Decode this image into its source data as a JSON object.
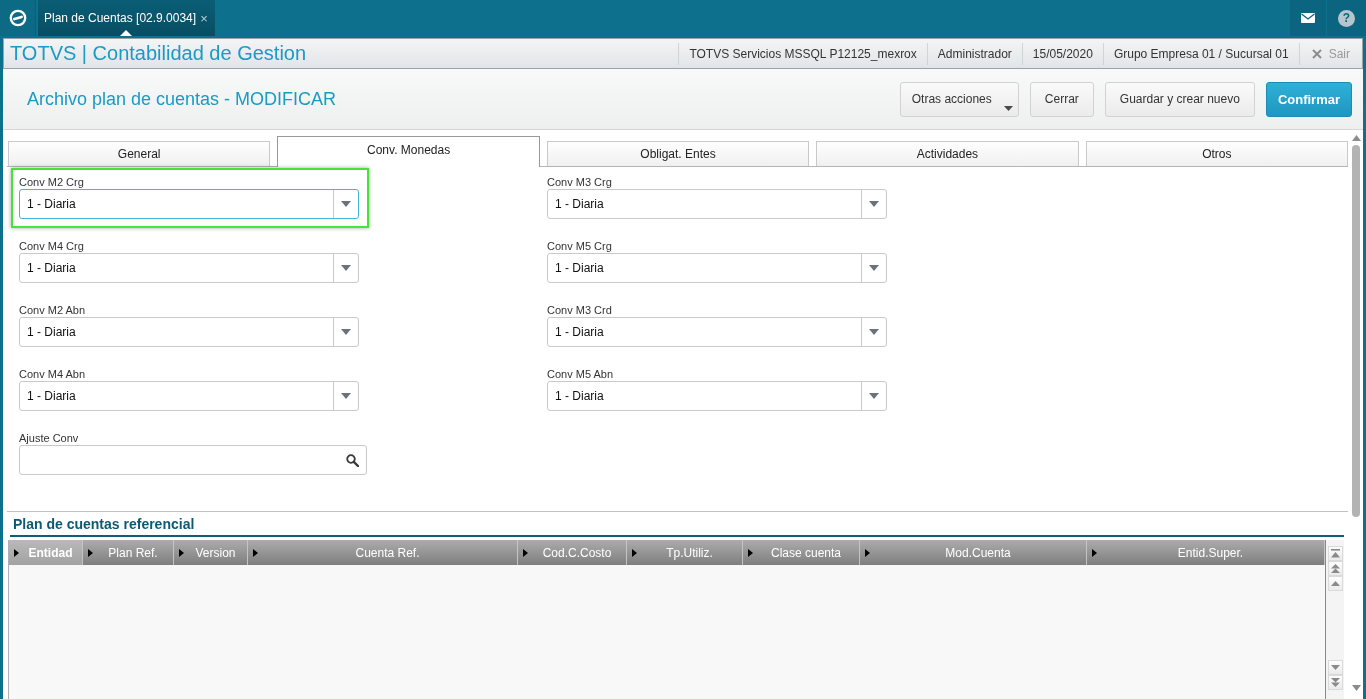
{
  "top_bar": {
    "tabs": [
      {
        "label": "Plan de Cuentas [02.9.0034]",
        "close": "×",
        "selected": true
      }
    ],
    "help": "?"
  },
  "app_bar": {
    "title": "TOTVS | Contabilidad de Gestion",
    "info": [
      "TOTVS Servicios MSSQL P12125_mexrox",
      "Administrador",
      "15/05/2020",
      "Grupo Empresa 01 / Sucursal 01"
    ],
    "logout": "Sair"
  },
  "page": {
    "title": "Archivo plan de cuentas - MODIFICAR",
    "buttons": [
      {
        "label": "Otras acciones",
        "kind": "menu"
      },
      {
        "label": "Cerrar",
        "kind": "default"
      },
      {
        "label": "Guardar y crear nuevo",
        "kind": "default"
      },
      {
        "label": "Confirmar",
        "kind": "primary"
      }
    ]
  },
  "tabs": [
    {
      "label": "General",
      "selected": false
    },
    {
      "label": "Conv. Monedas",
      "selected": true
    },
    {
      "label": "Obligat. Entes",
      "selected": false
    },
    {
      "label": "Actividades",
      "selected": false
    },
    {
      "label": "Otros",
      "selected": false
    }
  ],
  "fields": [
    {
      "label": "Conv M2 Crg",
      "kind": "select",
      "value": "1 - Diaria",
      "focused": true,
      "highlighted": true
    },
    {
      "label": "Conv M3 Crg",
      "kind": "select",
      "value": "1 - Diaria",
      "focused": false,
      "highlighted": false
    },
    {
      "label": "Conv M4 Crg",
      "kind": "select",
      "value": "1 - Diaria",
      "focused": false,
      "highlighted": false
    },
    {
      "label": "Conv M5 Crg",
      "kind": "select",
      "value": "1 - Diaria",
      "focused": false,
      "highlighted": false
    },
    {
      "label": "Conv M2 Abn",
      "kind": "select",
      "value": "1 - Diaria",
      "focused": false,
      "highlighted": false
    },
    {
      "label": "Conv M3 Crd",
      "kind": "select",
      "value": "1 - Diaria",
      "focused": false,
      "highlighted": false
    },
    {
      "label": "Conv M4 Abn",
      "kind": "select",
      "value": "1 - Diaria",
      "focused": false,
      "highlighted": false
    },
    {
      "label": "Conv M5 Abn",
      "kind": "select",
      "value": "1 - Diaria",
      "focused": false,
      "highlighted": false
    },
    {
      "label": "Ajuste Conv",
      "kind": "search",
      "focused": false,
      "highlighted": false
    }
  ],
  "grid": {
    "title": "Plan de cuentas referencial",
    "columns": [
      {
        "label": "Entidad",
        "selected": true
      },
      {
        "label": "Plan Ref.",
        "selected": false
      },
      {
        "label": "Version",
        "selected": false
      },
      {
        "label": "Cuenta Ref.",
        "selected": false
      },
      {
        "label": "Cod.C.Costo",
        "selected": false
      },
      {
        "label": "Tp.Utiliz.",
        "selected": false
      },
      {
        "label": "Clase cuenta",
        "selected": false
      },
      {
        "label": "Mod.Cuenta",
        "selected": false
      },
      {
        "label": "Entid.Super.",
        "selected": false
      }
    ]
  }
}
